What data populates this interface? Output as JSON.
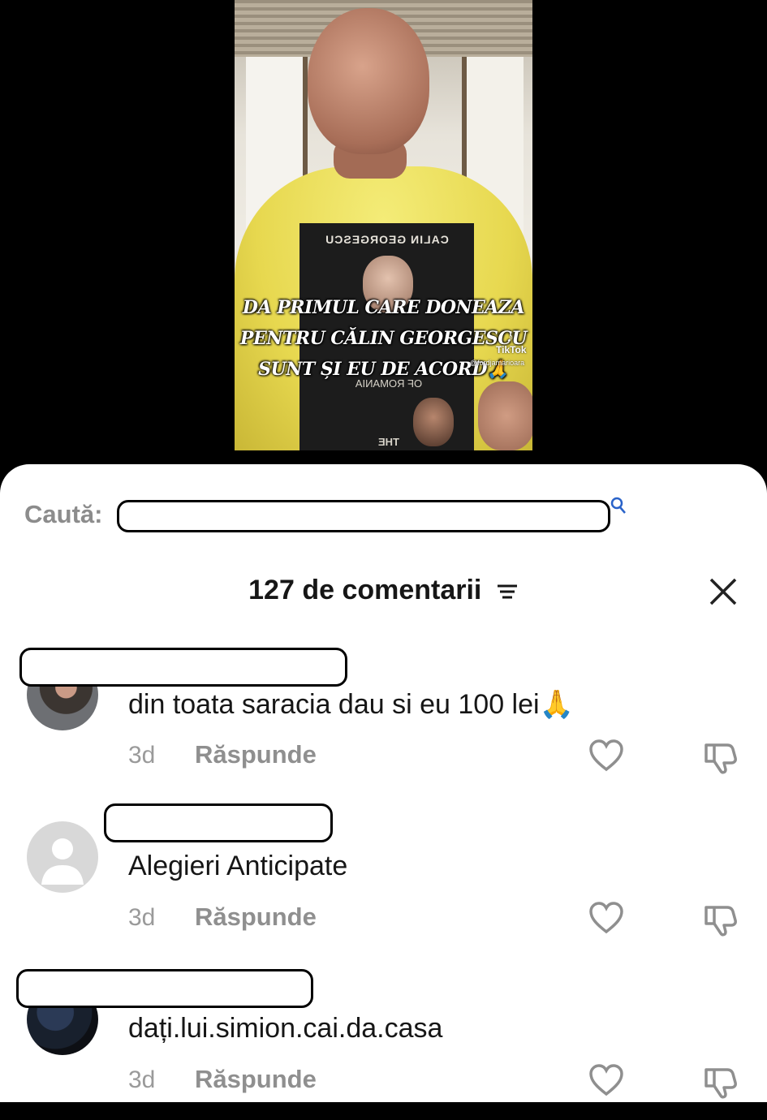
{
  "video": {
    "overlay_lines": [
      "DA PRIMUL CARE DONEAZA",
      "PENTRU  CĂLIN GEORGESCU",
      "SUNT ȘI  EU DE ACORD🙏"
    ],
    "shirt_title": "CALIN GEORGESCU",
    "shirt_sub": "OF ROMANIA",
    "shirt_bottom": "THE",
    "watermark_brand": "TikTok",
    "watermark_user": "@fordjamarioara"
  },
  "search": {
    "label": "Caută:",
    "placeholder": ""
  },
  "header": {
    "count_label": "127 de comentarii"
  },
  "comments": [
    {
      "text": "din toata saracia dau si eu 100 lei🙏",
      "age": "3d",
      "reply_label": "Răspunde"
    },
    {
      "text": "Alegieri Anticipate",
      "age": "3d",
      "reply_label": "Răspunde"
    },
    {
      "text": "dați.lui.simion.cai.da.casa",
      "age": "3d",
      "reply_label": "Răspunde"
    }
  ],
  "colors": {
    "sheet_bg": "#ffffff",
    "muted_text": "#8f8f8f",
    "primary_text": "#161616",
    "redaction_border": "#000000"
  }
}
